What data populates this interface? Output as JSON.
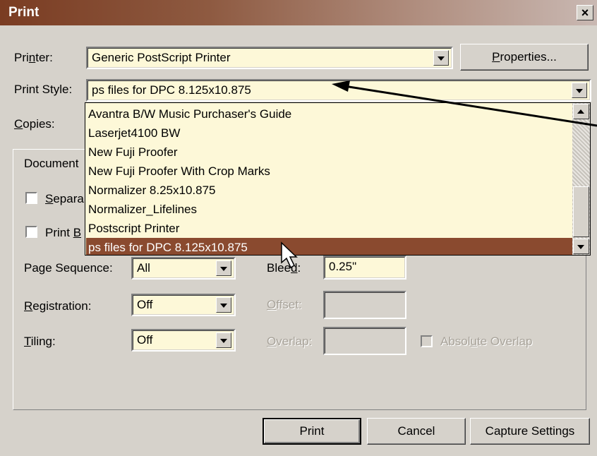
{
  "window": {
    "title": "Print",
    "close_glyph": "×"
  },
  "printer": {
    "label_pre": "Pri",
    "label_ul": "n",
    "label_post": "ter:",
    "value": "Generic PostScript Printer",
    "properties_pre": "",
    "properties_ul": "P",
    "properties_post": "roperties..."
  },
  "print_style": {
    "label": "Print Style:",
    "value": "ps files for DPC 8.125x10.875",
    "options": [
      "Avantra B/W Music Purchaser's Guide",
      "Laserjet4100 BW",
      "New Fuji Proofer",
      "New Fuji Proofer With Crop Marks",
      "Normalizer 8.25x10.875",
      "Normalizer_Lifelines",
      "Postscript Printer",
      "ps files for DPC 8.125x10.875"
    ],
    "selected_index": 7
  },
  "copies": {
    "label_ul": "C",
    "label_post": "opies:"
  },
  "document_tab": {
    "label": "Document"
  },
  "separations": {
    "label_ul": "S",
    "label_post": "epara"
  },
  "print_blank": {
    "label_pre": "Print ",
    "label_ul": "B"
  },
  "page_sequence": {
    "label": "Page Sequence:",
    "value": "All"
  },
  "registration": {
    "label_ul": "R",
    "label_post": "egistration:",
    "value": "Off"
  },
  "tiling": {
    "label_ul": "T",
    "label_post": "iling:",
    "value": "Off"
  },
  "bleed": {
    "label_pre": "Blee",
    "label_ul": "d",
    "label_post": ":",
    "value": "0.25\""
  },
  "offset": {
    "label_ul": "O",
    "label_post": "ffset:",
    "value": ""
  },
  "overlap": {
    "label_ul": "O",
    "label_post": "verlap:",
    "value": ""
  },
  "absolute_overlap": {
    "label_pre": "Absol",
    "label_ul": "u",
    "label_post": "te Overlap"
  },
  "buttons": {
    "print": "Print",
    "cancel": "Cancel",
    "capture": "Capture Settings"
  },
  "colors": {
    "accent": "#8a4a2f",
    "field_bg": "#fdf8d8",
    "dialog_bg": "#d6d2cb"
  },
  "icons": {
    "close": "close-icon",
    "cursor": "mouse-pointer-icon",
    "arrow": "annotation-arrow-icon"
  }
}
